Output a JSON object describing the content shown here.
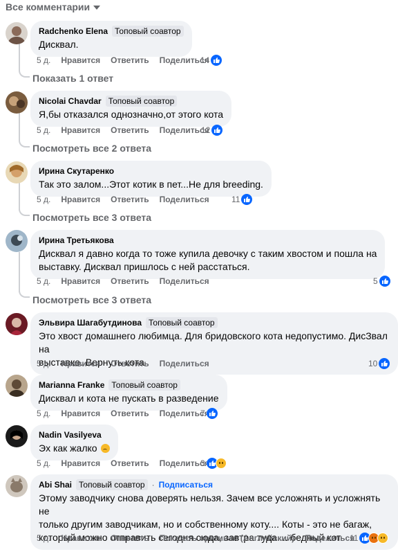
{
  "filter": {
    "label": "Все комментарии",
    "icon": "caret-down-icon"
  },
  "actions": {
    "like": "Нравится",
    "reply": "Ответить",
    "share": "Поделиться",
    "translate": "Показать оригинал (Английский)"
  },
  "comments": [
    {
      "author": "Radchenko Elena",
      "badge": "Топовый соавтор",
      "text": "Дисквал.",
      "time": "5 д.",
      "likes": "14",
      "replies_link": "Показать 1 ответ"
    },
    {
      "author": "Nicolai Chavdar",
      "badge": "Топовый соавтор",
      "text": "Я,бы отказался однозначно,от этого кота",
      "time": "5 д.",
      "likes": "12",
      "replies_link": "Посмотреть все 2 ответа"
    },
    {
      "author": "Ирина Скутаренко",
      "text": "Так это залом...Этот котик в пет...Не для breeding.",
      "time": "5 д.",
      "likes": "11",
      "replies_link": "Посмотреть все 3 ответа"
    },
    {
      "author": "Ирина Третьякова",
      "text_lines": [
        "Дисквал я давно когда то тоже купила девочку с таким хвостом и пошла на",
        "выставку. Дисквал пришлось с ней расстаться."
      ],
      "time": "5 д.",
      "likes": "5",
      "replies_link": "Посмотреть все 3 ответа"
    },
    {
      "author": "Эльвира Шагабутдинова",
      "badge": "Топовый соавтор",
      "text_lines": [
        "Это хвост домашнего любимца. Для бридовского кота недопустимо. ДисЗвал на",
        "выставке. Вернуть кота"
      ],
      "time": "5 д.",
      "likes": "10"
    },
    {
      "author": "Marianna Franke",
      "badge": "Топовый соавтор",
      "text": "Дисквал и кота не пускать в разведение",
      "time": "5 д.",
      "likes": "7"
    },
    {
      "author": "Nadin Vasilyeva",
      "text": "Эх как жалко",
      "time": "5 д.",
      "likes": "3"
    },
    {
      "author": "Abi Shai",
      "badge": "Топовый соавтор",
      "separator": "·",
      "subscribe": "Подписаться",
      "text_lines": [
        "Этому заводчику снова доверять нельзя. Зачем все усложнять и усложнять не",
        "только другим заводчикам, но и собственному коту.... Коты - это не багаж,",
        "который можно отправить сегодня сюда, завтра туда.... бедный кот"
      ],
      "time": "5 д.",
      "likes": "11"
    }
  ],
  "colors": {
    "bubble": "#f0f2f5",
    "accent": "#0866ff",
    "muted": "#65676b"
  }
}
